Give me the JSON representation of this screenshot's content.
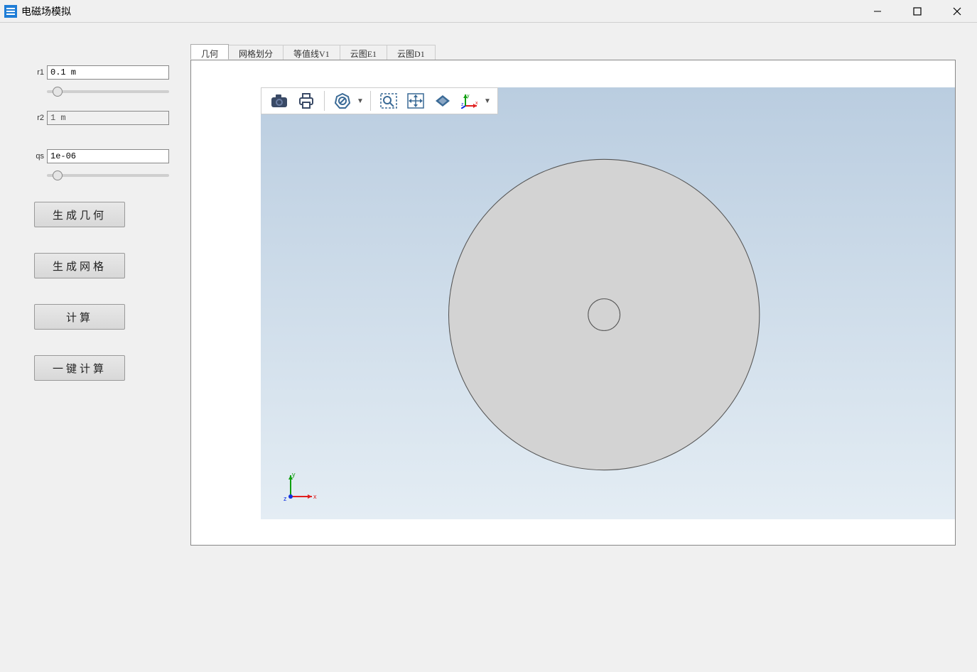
{
  "window": {
    "title": "电磁场模拟"
  },
  "sidebar": {
    "params": {
      "r1": {
        "label": "r1",
        "value": "0.1 m"
      },
      "r2": {
        "label": "r2",
        "value": "1 m"
      },
      "qs": {
        "label": "qs",
        "value": "1e-06"
      }
    },
    "buttons": {
      "gen_geom": "生成几何",
      "gen_mesh": "生成网格",
      "compute": "计算",
      "compute_all": "一键计算"
    }
  },
  "tabs": [
    {
      "id": "geom",
      "label": "几何",
      "active": true
    },
    {
      "id": "mesh",
      "label": "网格划分",
      "active": false
    },
    {
      "id": "contour_v1",
      "label": "等值线V1",
      "active": false
    },
    {
      "id": "cloud_e1",
      "label": "云图E1",
      "active": false
    },
    {
      "id": "cloud_d1",
      "label": "云图D1",
      "active": false
    }
  ],
  "toolbar_icons": {
    "camera": "camera-icon",
    "print": "print-icon",
    "nodraw": "no-symbol-icon",
    "zoombox": "zoom-box-icon",
    "pan": "pan-icon",
    "fit": "fit-icon",
    "axes": "axes-icon"
  },
  "axes_labels": {
    "x": "x",
    "y": "y",
    "z": "z"
  }
}
